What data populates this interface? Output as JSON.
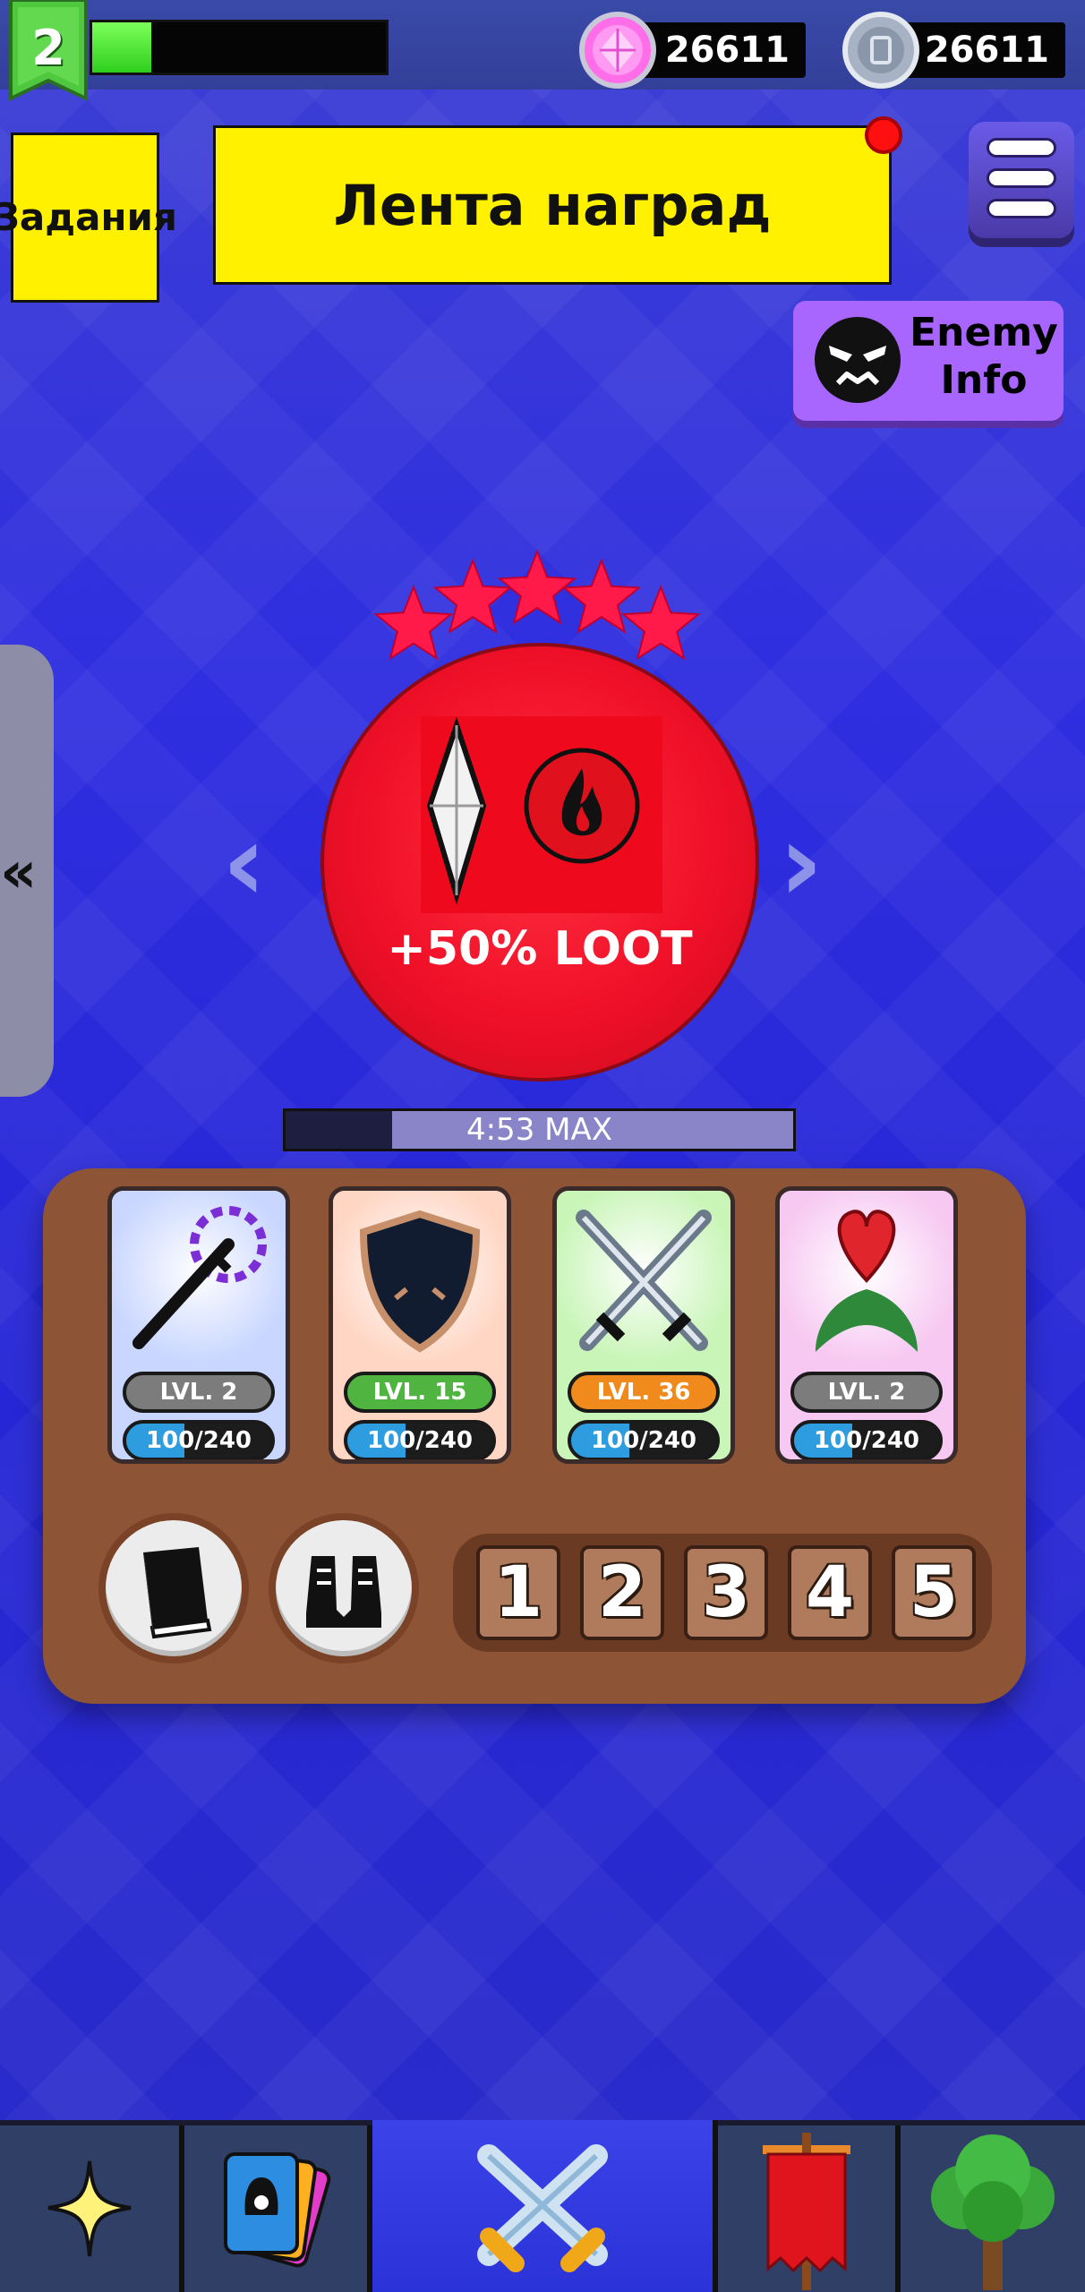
{
  "top_bar": {
    "level": "2",
    "xp_progress": 0.2,
    "gems": "26611",
    "coins": "26611",
    "icons": {
      "gem": "gem-icon",
      "coin": "coin-icon"
    }
  },
  "buttons": {
    "quests": "Задания",
    "reward_feed": "Лента наград",
    "enemy_info": "Enemy Info",
    "menu_icon": "hamburger-icon"
  },
  "boss": {
    "stars": 5,
    "loot_bonus": "+50% LOOT",
    "timer": "4:53 MAX",
    "timer_progress": 0.21,
    "icons": [
      "crystal-icon",
      "fire-icon"
    ]
  },
  "skills": [
    {
      "name": "dagger",
      "level": "LVL. 2",
      "progress": "100/240",
      "level_color": "#7c7c7c",
      "bg": "#c9d6ff"
    },
    {
      "name": "shield",
      "level": "LVL. 15",
      "progress": "100/240",
      "level_color": "#4fb540",
      "bg": "#ffd6c4"
    },
    {
      "name": "swords",
      "level": "LVL. 36",
      "progress": "100/240",
      "level_color": "#f08a1c",
      "bg": "#c9f5b8"
    },
    {
      "name": "heart",
      "level": "LVL. 2",
      "progress": "100/240",
      "level_color": "#7c7c7c",
      "bg": "#f7c9f2"
    }
  ],
  "slots": [
    "1",
    "2",
    "3",
    "4",
    "5"
  ],
  "bottom_nav": [
    "sparkle-icon",
    "cards-icon",
    "battle-icon",
    "banner-icon",
    "tree-icon"
  ],
  "colors": {
    "background": "#2f2ee0",
    "accent_yellow": "#fff100",
    "boss_red": "#f01028",
    "panel_brown": "#8e5436",
    "enemy_purple": "#a866ff"
  }
}
